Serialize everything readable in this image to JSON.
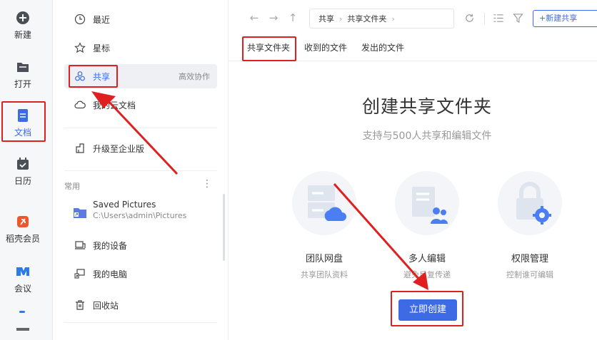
{
  "rail": {
    "items": [
      {
        "label": "新建",
        "icon": "plus-circle-icon"
      },
      {
        "label": "打开",
        "icon": "folder-icon"
      },
      {
        "label": "文档",
        "icon": "document-icon"
      },
      {
        "label": "日历",
        "icon": "calendar-icon"
      },
      {
        "label": "稻壳会员",
        "icon": "docer-icon"
      },
      {
        "label": "会议",
        "icon": "meeting-icon"
      }
    ]
  },
  "nav": {
    "recent": "最近",
    "starred": "星标",
    "shared": "共享",
    "shared_side": "高效协作",
    "cloud_docs": "我的云文档",
    "upgrade": "升级至企业版",
    "section_common": "常用",
    "saved_pictures_title": "Saved Pictures",
    "saved_pictures_path": "C:\\Users\\admin\\Pictures",
    "my_devices": "我的设备",
    "my_computer": "我的电脑",
    "recycle_bin": "回收站"
  },
  "toolbar": {
    "crumb_root": "共享",
    "crumb_current": "共享文件夹",
    "new_share_label": "+新建共享"
  },
  "tabs": [
    "共享文件夹",
    "收到的文件",
    "发出的文件"
  ],
  "hero": {
    "title": "创建共享文件夹",
    "subtitle": "支持与500人共享和编辑文件"
  },
  "features": [
    {
      "title": "团队网盘",
      "desc": "共享团队资料"
    },
    {
      "title": "多人编辑",
      "desc": "避免反复传递"
    },
    {
      "title": "权限管理",
      "desc": "控制谁可编辑"
    }
  ],
  "create_button": "立即创建",
  "colors": {
    "accent": "#3d6be5",
    "highlight": "#e02020"
  }
}
